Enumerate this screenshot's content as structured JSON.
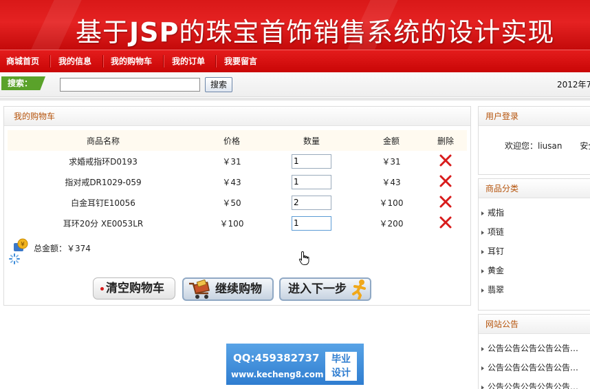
{
  "banner": {
    "title_prefix": "基于",
    "title_bold": "JSP",
    "title_suffix": "的珠宝首饰销售系统的设计实现"
  },
  "nav": [
    "商城首页",
    "我的信息",
    "我的购物车",
    "我的订单",
    "我要留言"
  ],
  "search": {
    "label": "搜索：",
    "value": "",
    "button": "搜索",
    "date": "2012年7"
  },
  "cart": {
    "title": "我的购物车",
    "headers": [
      "商品名称",
      "价格",
      "数量",
      "金额",
      "删除"
    ],
    "rows": [
      {
        "name": "求婚戒指环D0193",
        "price": "￥31",
        "qty": "1",
        "amount": "￥31"
      },
      {
        "name": "指对戒DR1029-059",
        "price": "￥43",
        "qty": "1",
        "amount": "￥43"
      },
      {
        "name": "白金耳钉E10056",
        "price": "￥50",
        "qty": "2",
        "amount": "￥100"
      },
      {
        "name": "耳环20分 XE0053LR",
        "price": "￥100",
        "qty": "1",
        "amount": "￥200"
      }
    ],
    "total": "总金额：￥374",
    "buttons": {
      "clear": "清空购物车",
      "continue": "继续购物",
      "next": "进入下一步"
    }
  },
  "login": {
    "title": "用户登录",
    "welcome": "欢迎您：liusan",
    "extra": "安全"
  },
  "categories": {
    "title": "商品分类",
    "items": [
      "戒指",
      "项链",
      "耳钉",
      "黄金",
      "翡翠"
    ]
  },
  "notices": {
    "title": "网站公告",
    "items": [
      "公告公告公告公告公告…",
      "公告公告公告公告公告…",
      "公告公告公告公告公告…"
    ]
  },
  "watermark": {
    "qq": "QQ:459382737",
    "url": "www.kecheng8.com",
    "badge_line1": "毕业",
    "badge_line2": "设计"
  },
  "colors": {
    "brand_red": "#d91818",
    "label_green": "#5aa22a",
    "heading_orange": "#b5530b",
    "delete_red": "#d81b1b"
  }
}
